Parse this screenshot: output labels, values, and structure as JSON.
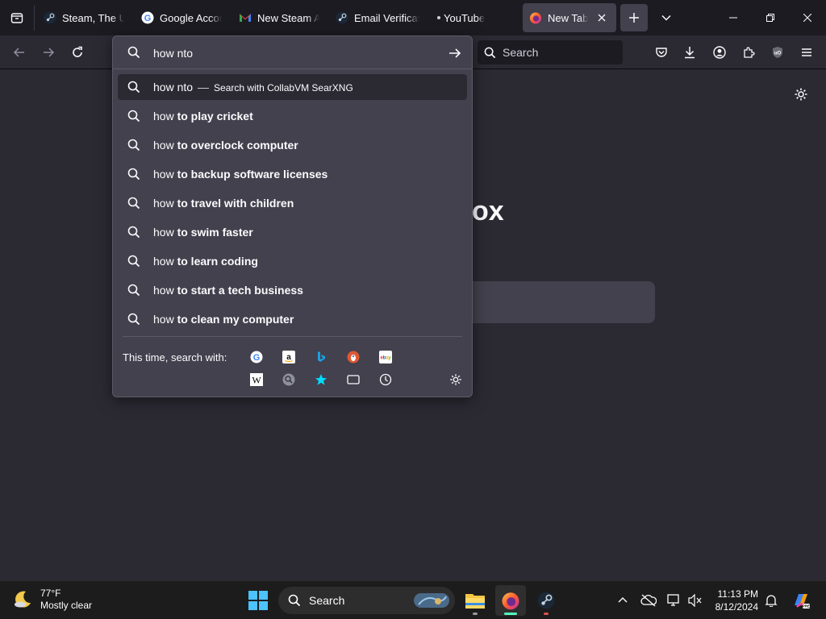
{
  "tabs": [
    {
      "label": "Steam, The Ul",
      "icon": "steam-icon"
    },
    {
      "label": "Google Accou",
      "icon": "google-icon"
    },
    {
      "label": "New Steam Ac",
      "icon": "gmail-icon"
    },
    {
      "label": "Email Verificat",
      "icon": "steam-icon"
    },
    {
      "label": "YouTube",
      "icon": "dot-icon"
    },
    {
      "label": "New Tab",
      "icon": "firefox-icon",
      "active": true
    }
  ],
  "navbar": {
    "search_placeholder": "Search"
  },
  "urlbar": {
    "value": "how nto",
    "heuristic": {
      "text": "how nto",
      "separator": "—",
      "action": "Search with CollabVM SearXNG"
    },
    "suggestions": [
      {
        "prefix": "how",
        "bold": "to play cricket"
      },
      {
        "prefix": "how",
        "bold": "to overclock computer"
      },
      {
        "prefix": "how",
        "bold": "to backup software licenses"
      },
      {
        "prefix": "how",
        "bold": "to travel with children"
      },
      {
        "prefix": "how",
        "bold": "to swim faster"
      },
      {
        "prefix": "how",
        "bold": "to learn coding"
      },
      {
        "prefix": "how",
        "bold": "to start a tech business"
      },
      {
        "prefix": "how",
        "bold": "to clean my computer"
      }
    ],
    "oneoff_label": "This time, search with:",
    "oneoff_engines": [
      "google-icon",
      "amazon-icon",
      "bing-icon",
      "duckduckgo-icon",
      "ebay-icon",
      "wikipedia-icon",
      "searxng-icon",
      "bookmarks-icon",
      "tabs-icon",
      "history-icon"
    ]
  },
  "page": {
    "wordmark_fragment": "ox"
  },
  "taskbar": {
    "weather_temp": "77°F",
    "weather_desc": "Mostly clear",
    "search_label": "Search",
    "time": "11:13 PM",
    "date": "8/12/2024"
  },
  "colors": {
    "accent_teal": "#00ddff",
    "firefox_indicator": "#54ffbd"
  }
}
